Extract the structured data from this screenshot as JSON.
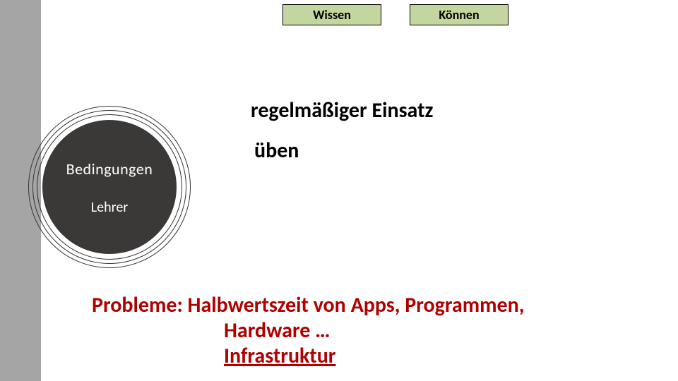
{
  "pills": {
    "wissen": "Wissen",
    "koennen": "Können"
  },
  "circle": {
    "line1": "Bedingungen",
    "line2": "Lehrer"
  },
  "content": {
    "line1": "regelmäßiger Einsatz",
    "line2": "üben"
  },
  "problems": {
    "line1": "Probleme: Halbwertszeit von Apps, Programmen,",
    "line2": "Hardware …",
    "line3": "Infrastruktur"
  }
}
